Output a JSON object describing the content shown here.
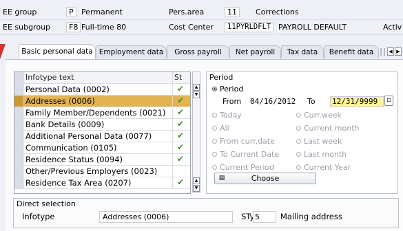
{
  "header": {
    "ee_group_label": "EE group",
    "ee_group_code": "P",
    "ee_group_text": "Permanent",
    "pers_area_label": "Pers.area",
    "pers_area_code": "11",
    "pers_area_text": "Corrections",
    "ee_subgroup_label": "EE subgroup",
    "ee_subgroup_code": "F8",
    "ee_subgroup_text": "Full-time 80",
    "cost_center_label": "Cost Center",
    "cost_center_code": "11PYRLDFLT",
    "cost_center_text": "PAYROLL DEFAULT",
    "status_text": "Activ"
  },
  "tabs": [
    {
      "label": "Basic personal data",
      "active": true
    },
    {
      "label": "Employment data"
    },
    {
      "label": "Gross payroll"
    },
    {
      "label": "Net payroll"
    },
    {
      "label": "Tax data"
    },
    {
      "label": "Benefit data"
    }
  ],
  "infotype_table": {
    "col_text": "Infotype text",
    "col_status": "St",
    "rows": [
      {
        "text": "Personal Data (0002)",
        "checked": true
      },
      {
        "text": "Addresses (0006)",
        "checked": true,
        "selected": true
      },
      {
        "text": "Family Member/Dependents (0021)",
        "checked": true
      },
      {
        "text": "Bank Details (0009)",
        "checked": true
      },
      {
        "text": "Additional Personal Data (0077)",
        "checked": true
      },
      {
        "text": "Communication (0105)",
        "checked": true
      },
      {
        "text": "Residence Status (0094)",
        "checked": true
      },
      {
        "text": "Other/Previous Employers (0023)",
        "checked": false
      },
      {
        "text": "Residence Tax Area (0207)",
        "checked": true
      }
    ],
    "check_glyph": "✔"
  },
  "period": {
    "group_title": "Period",
    "period_label": "Period",
    "from_label": "From",
    "from_value": "04/16/2012",
    "to_label": "To",
    "to_value": "12/31/9999",
    "today": "Today",
    "all": "All",
    "from_curr_date": "From curr.date",
    "to_current_date": "To Current Date",
    "current_period": "Current Period",
    "curr_week": "Curr.week",
    "current_month": "Current month",
    "last_week": "Last week",
    "last_month": "Last month",
    "current_year": "Current Year",
    "choose_label": "Choose"
  },
  "direct_selection": {
    "title": "Direct selection",
    "infotype_label": "Infotype",
    "infotype_value": "Addresses (0006)",
    "sty_label": "STy",
    "sty_value": "5",
    "sty_text": "Mailing address"
  },
  "colors": {
    "selected_row": "#e3b454",
    "check_green": "#3f8e2a",
    "to_field_bg": "#fff3a0",
    "tab_accent": "#d2342e"
  }
}
